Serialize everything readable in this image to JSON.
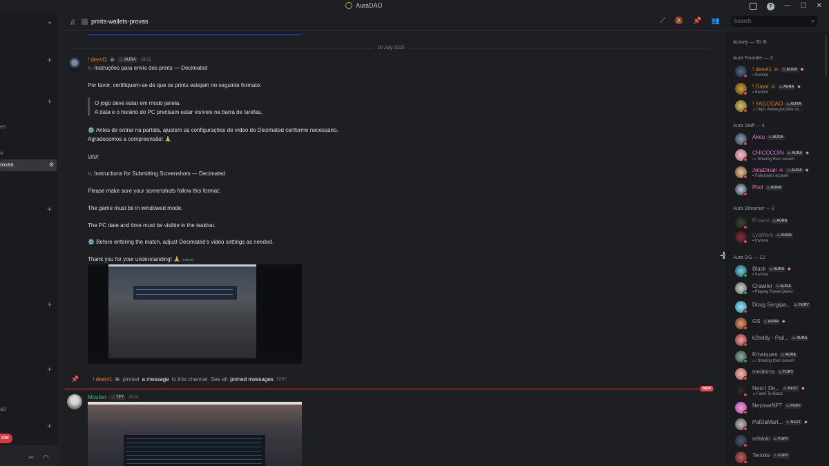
{
  "window": {
    "app_title": "AuraDAO"
  },
  "channel": {
    "name": "prints-wallets-provas"
  },
  "search": {
    "placeholder": "Search"
  },
  "left_sidebar": {
    "fragments": [
      "es",
      "o",
      "a2"
    ],
    "active_channel_fragment": "rovas",
    "badge_fragment": "ION"
  },
  "messages": {
    "date_divider": "10 July 2025",
    "message1": {
      "author": "! deevl1",
      "tag": "AURA",
      "time": "19:51",
      "lines": [
        "Instruções para envio dos prints — Decimated",
        "Por favor, certifiquem-se de que os prints estejam no seguinte formato:",
        "O jogo deve estar em modo janela.",
        "A data e o horário do PC precisam estar visíveis na barra de tarefas.",
        "⚙️ Antes de entrar na partida, ajustem as configurações de vídeo do Decimated conforme necessário.",
        "Agradecemos a compreensão! 🙏",
        "///////",
        "Instructions for Submitting Screenshots — Decimated",
        "Please make sure your screenshots follow this format:",
        "The game must be in windowed mode.",
        "The PC date and time must be visible in the taskbar.",
        "⚙️ Before entering the match, adjust Decimated’s video settings as needed.",
        "Thank you for your understanding! 🙏"
      ],
      "edited": "(edited)"
    },
    "pin_notice": {
      "author": "! deevl1",
      "text_pinned": "pinned",
      "text_a_message": "a message",
      "text_to_channel": "to this channel. See all",
      "text_pinned_messages": "pinned messages",
      "time": "19:57"
    },
    "new_badge": "NEW",
    "message2": {
      "author": "Mouber",
      "tag": "TFT",
      "time": "20:01"
    }
  },
  "members": {
    "activity_label": "Activity — 30",
    "groups": [
      {
        "label": "Aura Founder — 3",
        "members": [
          {
            "name": "! deevl1",
            "tag": "AURA",
            "status": "Invoice",
            "boost": true
          },
          {
            "name": "! Giant",
            "tag": "AURA",
            "status": "Invoice",
            "boost": true
          },
          {
            "name": "! YAGODAO",
            "tag": "AURA",
            "status": "https://www.youtube.co...",
            "boost": false
          }
        ]
      },
      {
        "label": "Aura Staff — 4",
        "members": [
          {
            "name": "Akeu",
            "tag": "AURA",
            "status": "",
            "boost": false
          },
          {
            "name": "CHICOCOIN",
            "tag": "AURA",
            "status": "Sharing their screen",
            "boost": true
          },
          {
            "name": "JotaDinall",
            "tag": "AURA",
            "status": "Fala baixo alcanei",
            "boost": false
          },
          {
            "name": "Pitol",
            "tag": "AURA",
            "status": "",
            "boost": false
          }
        ]
      },
      {
        "label": "Aura Streamer — 2",
        "members": [
          {
            "name": "Frowni",
            "tag": "AURA",
            "status": "",
            "boost": false
          },
          {
            "name": "LyaMork",
            "tag": "AURA",
            "status": "Invoice",
            "boost": false
          }
        ]
      },
      {
        "label": "Aura OG — 12",
        "members": [
          {
            "name": "Black",
            "tag": "AURA",
            "status": "Invoice",
            "boost": true
          },
          {
            "name": "Crawller",
            "tag": "AURA",
            "status": "Playing RavenQuest",
            "boost": false
          },
          {
            "name": "Doug Sergipa...",
            "tag": "FURY",
            "status": "",
            "boost": false
          },
          {
            "name": "GS",
            "tag": "AURA",
            "status": "",
            "boost": true
          },
          {
            "name": "k2eddy - Pali...",
            "tag": "AURA",
            "status": "",
            "boost": false
          },
          {
            "name": "Kmarques",
            "tag": "AURA",
            "status": "Sharing their screen",
            "boost": false
          },
          {
            "name": "medeiros",
            "tag": "FURY",
            "status": "",
            "boost": false
          },
          {
            "name": "Nest | De...",
            "tag": "NEST",
            "status": "Fade To Black",
            "boost": true
          },
          {
            "name": "NeymarNFT",
            "tag": "FURY",
            "status": "",
            "boost": false
          },
          {
            "name": "PalDaMarl...",
            "tag": "NEST",
            "status": "",
            "boost": true
          },
          {
            "name": "rafalaki",
            "tag": "FURY",
            "status": "",
            "boost": false
          },
          {
            "name": "Tenoke",
            "tag": "FURY",
            "status": "",
            "boost": false
          }
        ]
      }
    ]
  }
}
